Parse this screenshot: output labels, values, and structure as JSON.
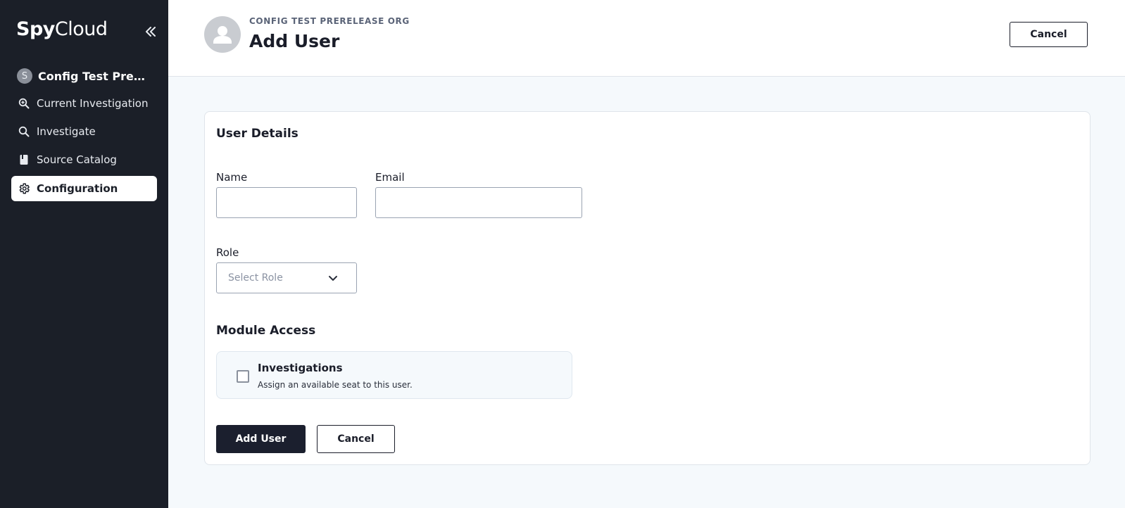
{
  "sidebar": {
    "logo_bold": "Spy",
    "logo_light": "Cloud",
    "org_initial": "S",
    "org_name": "Config Test PreRelease Org",
    "items": [
      {
        "label": "Current Investigation",
        "icon": "zoom-in-icon"
      },
      {
        "label": "Investigate",
        "icon": "search-icon"
      },
      {
        "label": "Source Catalog",
        "icon": "book-icon"
      },
      {
        "label": "Configuration",
        "icon": "gear-icon",
        "active": true
      }
    ]
  },
  "header": {
    "org_label": "CONFIG TEST PRERELEASE ORG",
    "title": "Add User",
    "cancel_label": "Cancel"
  },
  "form": {
    "section_title": "User Details",
    "name_label": "Name",
    "name_value": "",
    "email_label": "Email",
    "email_value": "",
    "role_label": "Role",
    "role_placeholder": "Select Role",
    "module_title": "Module Access",
    "module_item_title": "Investigations",
    "module_item_desc": "Assign an available seat to this user.",
    "module_item_checked": false,
    "submit_label": "Add User",
    "cancel_label": "Cancel"
  },
  "colors": {
    "sidebar_bg": "#1b1f28",
    "primary": "#1b1f2e",
    "page_bg": "#f5f9fc"
  }
}
